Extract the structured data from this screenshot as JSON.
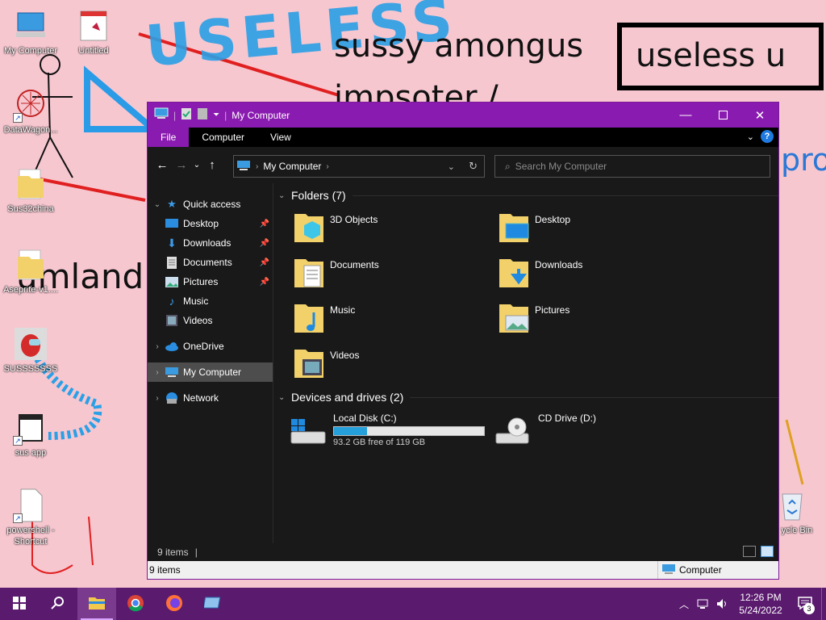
{
  "desktop": {
    "wallpaper_texts": {
      "big_scribble": "USELESS",
      "sussy": "sussy amongus",
      "impsoter": "impsoter /",
      "useless_u": "useless u",
      "umland": "umland",
      "pro": "pro"
    },
    "icons": [
      {
        "label": "My Computer",
        "icon": "computer-icon"
      },
      {
        "label": "Untitled",
        "icon": "image-file-icon"
      },
      {
        "label": "DataWagon...",
        "icon": "app-shortcut-icon"
      },
      {
        "label": "Sus32china",
        "icon": "folder-icon"
      },
      {
        "label": "Aseprite-v1....",
        "icon": "folder-icon"
      },
      {
        "label": "SUSSSSSSS",
        "icon": "amongus-image-icon"
      },
      {
        "label": "sus app",
        "icon": "app-shortcut-icon"
      },
      {
        "label": "powershell - Shortcut",
        "icon": "file-shortcut-icon"
      },
      {
        "label": "Recycle Bin",
        "icon": "recycle-bin-icon"
      }
    ],
    "recycle_label_visible": "ycle Bin"
  },
  "explorer": {
    "title": "My Computer",
    "ribbon_tabs": [
      "File",
      "Computer",
      "View"
    ],
    "address_crumb": "My Computer",
    "search_placeholder": "Search My Computer",
    "nav": {
      "quick_access": "Quick access",
      "quick_items": [
        "Desktop",
        "Downloads",
        "Documents",
        "Pictures",
        "Music",
        "Videos"
      ],
      "onedrive": "OneDrive",
      "my_computer": "My Computer",
      "network": "Network"
    },
    "folders_header": "Folders (7)",
    "folders": [
      "3D Objects",
      "Desktop",
      "Documents",
      "Downloads",
      "Music",
      "Pictures",
      "Videos"
    ],
    "devices_header": "Devices and drives (2)",
    "drives": [
      {
        "name": "Local Disk (C:)",
        "free_text": "93.2 GB free of 119 GB",
        "used_fraction": 0.22
      },
      {
        "name": "CD Drive (D:)"
      }
    ],
    "status_count": "9 items",
    "info_count": "9 items",
    "info_location": "Computer",
    "accent_color": "#8a1bb0"
  },
  "taskbar": {
    "apps": [
      "start-button",
      "search-button",
      "file-explorer",
      "chrome",
      "firefox",
      "control-panel"
    ],
    "time": "12:26 PM",
    "date": "5/24/2022",
    "notification_count": "3"
  }
}
